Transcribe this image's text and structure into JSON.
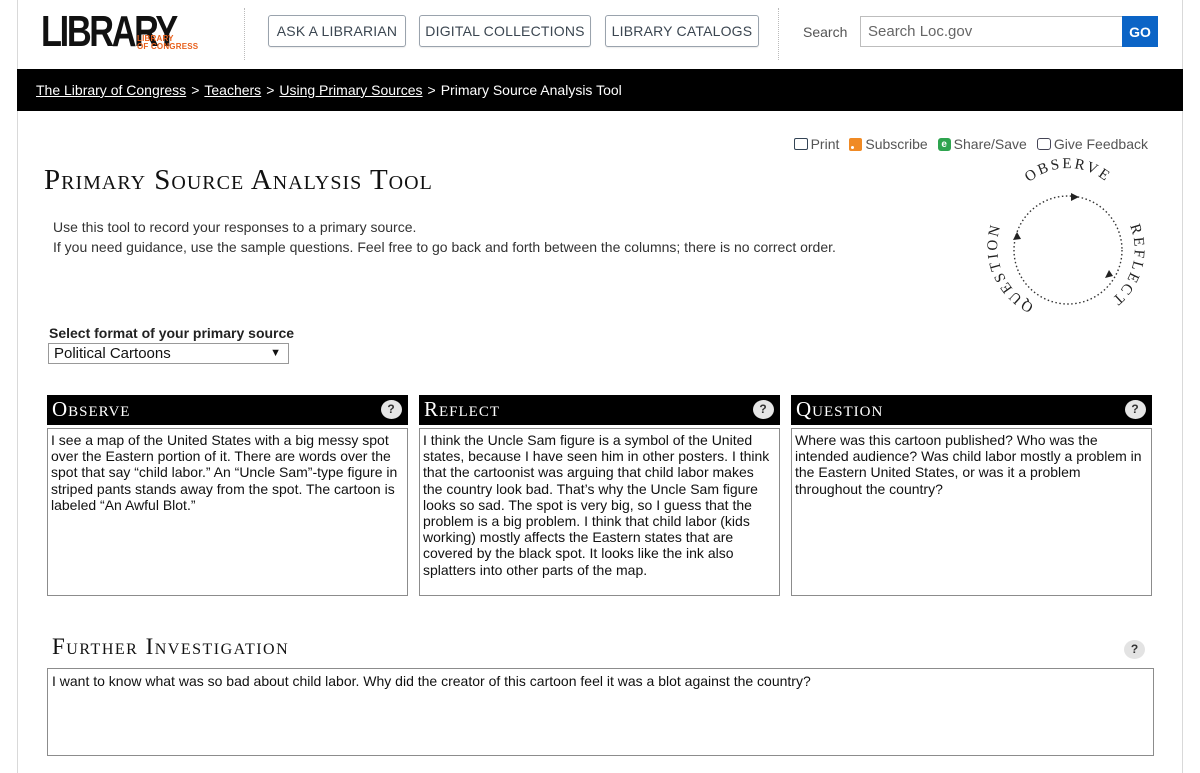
{
  "header": {
    "logo_main": "LIBRARY",
    "logo_sub_1": "LIBRARY",
    "logo_sub_2": "OF CONGRESS",
    "nav": [
      {
        "label": "ASK A LIBRARIAN"
      },
      {
        "label": "DIGITAL COLLECTIONS"
      },
      {
        "label": "LIBRARY CATALOGS"
      }
    ],
    "search_label": "Search",
    "search_placeholder": "Search Loc.gov",
    "go_label": "GO"
  },
  "breadcrumb": {
    "items": [
      "The Library of Congress",
      "Teachers",
      "Using Primary Sources"
    ],
    "current": "Primary Source Analysis Tool",
    "separator": ">"
  },
  "tools": {
    "print": "Print",
    "subscribe": "Subscribe",
    "share": "Share/Save",
    "feedback": "Give Feedback"
  },
  "page": {
    "title": "Primary Source Analysis Tool",
    "intro_1": "Use this tool to record your responses to a primary source.",
    "intro_2": "If you need guidance, use the sample questions. Feel free to go back and forth between the columns; there is no correct order."
  },
  "cycle": {
    "observe": "OBSERVE",
    "reflect": "REFLECT",
    "question": "QUESTION"
  },
  "format": {
    "label": "Select format of your primary source",
    "selected": "Political Cartoons"
  },
  "columns": [
    {
      "title": "Observe",
      "text": "I see a map of the United States with a big messy spot over the Eastern portion of it. There are words over the spot that say “child labor.” An “Uncle Sam”-type figure in striped pants stands away from the spot. The cartoon is labeled “An Awful Blot.”"
    },
    {
      "title": "Reflect",
      "text": "I think the Uncle Sam figure is a symbol of the United states, because I have seen him in other posters. I think that the cartoonist was arguing that child labor makes the country look bad. That’s why the Uncle Sam figure looks so sad. The spot is very big, so I guess that the problem is a big problem. I think that child labor (kids working) mostly affects the Eastern states that are covered by the black spot. It looks like the ink also splatters into other parts of the map."
    },
    {
      "title": "Question",
      "text": "Where was this cartoon published? Who was the intended audience? Was child labor mostly a problem in the Eastern United States, or was it a problem throughout the country?"
    }
  ],
  "further": {
    "title": "Further Investigation",
    "text": "I want to know what was so bad about child labor. Why did the creator of this cartoon feel it was a blot against the country?"
  },
  "help_glyph": "?",
  "colors": {
    "accent_blue": "#0b64c6",
    "logo_orange": "#e8601c",
    "bar_black": "#000000"
  }
}
